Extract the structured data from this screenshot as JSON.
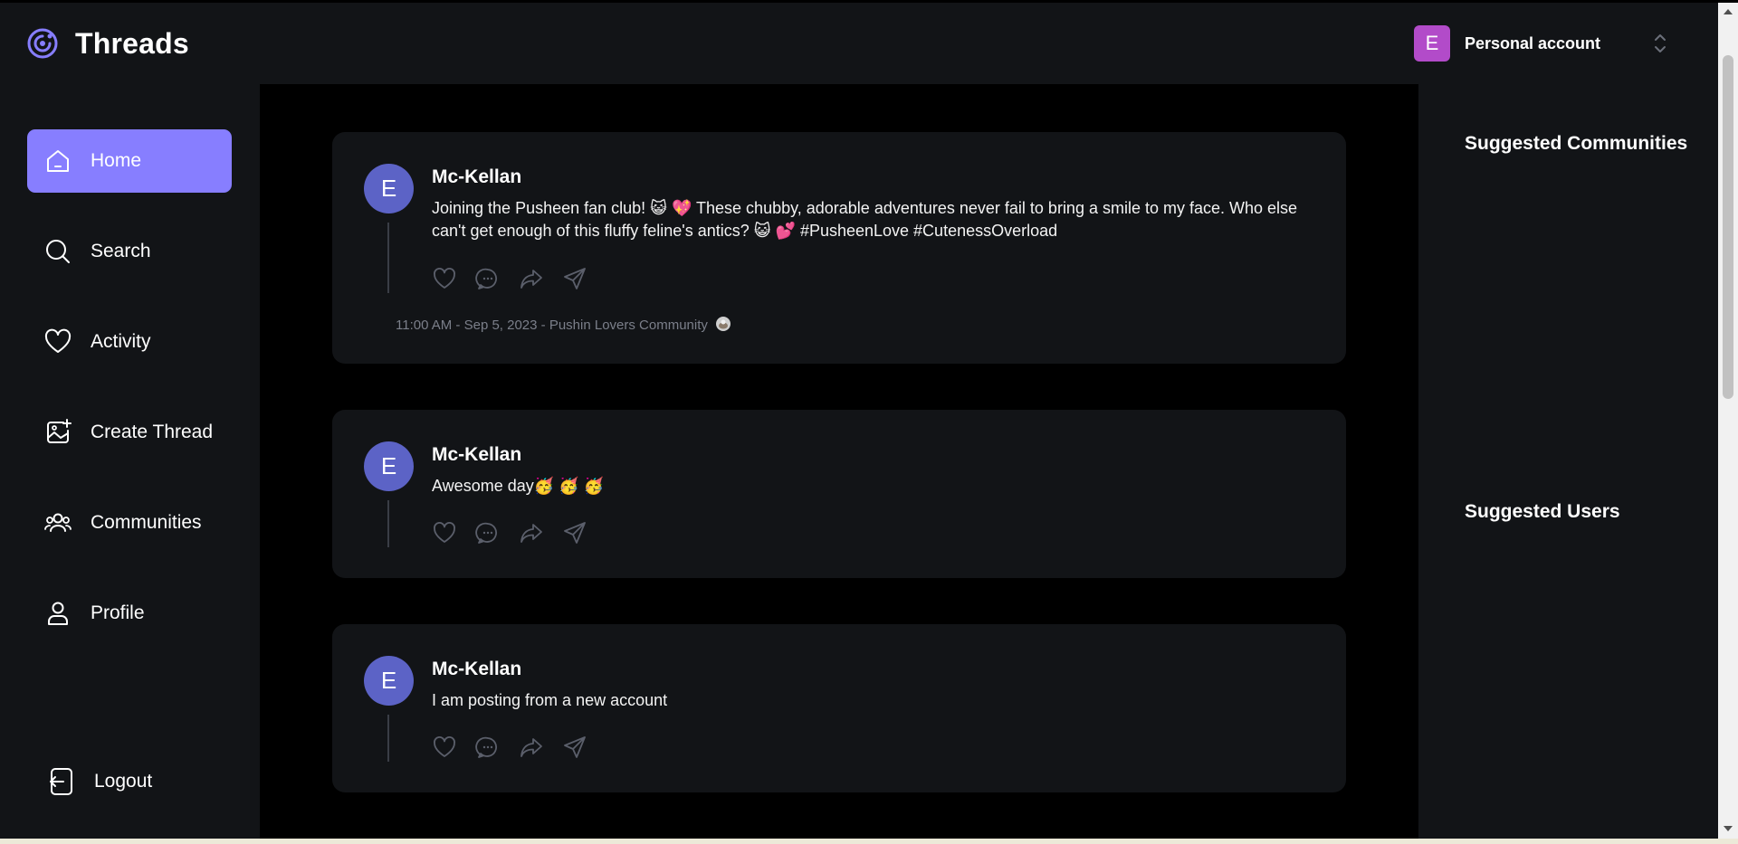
{
  "brand": {
    "title": "Threads",
    "logo_icon": "threads-logo-icon",
    "accent": "#877eff"
  },
  "account": {
    "initial": "E",
    "name": "Personal account",
    "avatar_color": "#b24bc9"
  },
  "nav": {
    "items": [
      {
        "label": "Home",
        "icon": "home-icon",
        "active": true
      },
      {
        "label": "Search",
        "icon": "search-icon"
      },
      {
        "label": "Activity",
        "icon": "heart-icon"
      },
      {
        "label": "Create Thread",
        "icon": "create-thread-icon"
      },
      {
        "label": "Communities",
        "icon": "communities-icon"
      },
      {
        "label": "Profile",
        "icon": "profile-icon"
      }
    ],
    "logout_label": "Logout"
  },
  "threads": [
    {
      "initial": "E",
      "author": "Mc-Kellan",
      "text": "Joining the Pusheen fan club! 😺 💖  These chubby, adorable adventures never fail to bring a smile to my face. Who else can't get enough of this fluffy feline's antics? 😺 💕  #PusheenLove #CutenessOverload",
      "meta": "11:00 AM - Sep 5, 2023 - Pushin Lovers Community",
      "meta_icon": "community-image-icon"
    },
    {
      "initial": "E",
      "author": "Mc-Kellan",
      "text": "Awesome day🥳 🥳 🥳"
    },
    {
      "initial": "E",
      "author": "Mc-Kellan",
      "text": "I am posting from a new account"
    }
  ],
  "right": {
    "communities_title": "Suggested Communities",
    "users_title": "Suggested Users"
  }
}
